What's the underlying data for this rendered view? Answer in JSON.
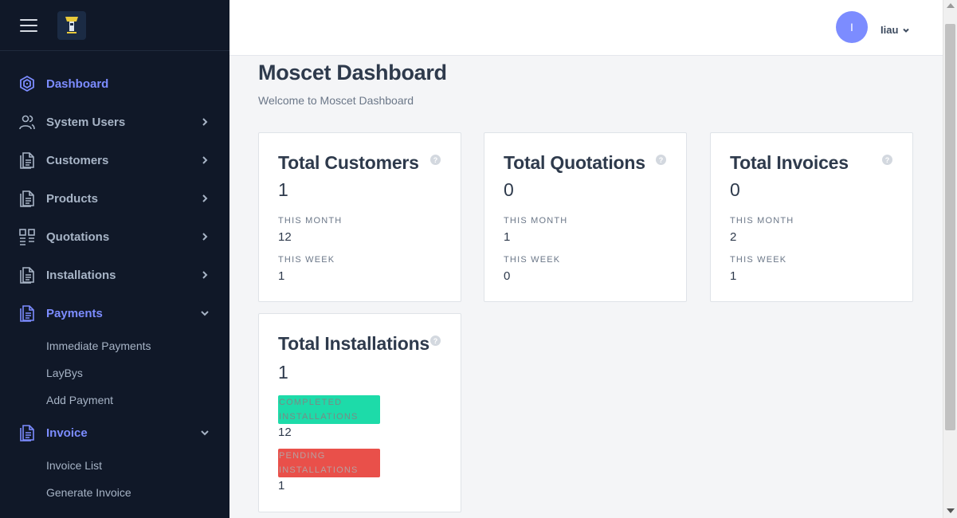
{
  "sidebar": {
    "items": [
      {
        "label": "Dashboard",
        "icon": "dashboard-icon"
      },
      {
        "label": "System Users",
        "icon": "users-icon"
      },
      {
        "label": "Customers",
        "icon": "document-icon"
      },
      {
        "label": "Products",
        "icon": "document-icon"
      },
      {
        "label": "Quotations",
        "icon": "grid-icon"
      },
      {
        "label": "Installations",
        "icon": "document-icon"
      },
      {
        "label": "Payments",
        "icon": "document-icon"
      },
      {
        "label": "Invoice",
        "icon": "document-icon"
      }
    ],
    "payments_sub": [
      "Immediate Payments",
      "LayBys",
      "Add Payment"
    ],
    "invoice_sub": [
      "Invoice List",
      "Generate Invoice"
    ]
  },
  "header": {
    "avatar_initial": "I",
    "username": "Iiau"
  },
  "main": {
    "title": "Moscet Dashboard",
    "subtitle": "Welcome to Moscet Dashboard",
    "cards": [
      {
        "title": "Total Customers",
        "value": "1",
        "this_month_label": "THIS MONTH",
        "this_month": "12",
        "this_week_label": "THIS WEEK",
        "this_week": "1"
      },
      {
        "title": "Total Quotations",
        "value": "0",
        "this_month_label": "THIS MONTH",
        "this_month": "1",
        "this_week_label": "THIS WEEK",
        "this_week": "0"
      },
      {
        "title": "Total Invoices",
        "value": "0",
        "this_month_label": "THIS MONTH",
        "this_month": "2",
        "this_week_label": "THIS WEEK",
        "this_week": "1"
      }
    ],
    "installations": {
      "title": "Total Installations",
      "value": "1",
      "completed_label": "COMPLETED INSTALLATIONS",
      "completed": "12",
      "pending_label": "PENDING INSTALLATIONS",
      "pending": "1"
    }
  },
  "colors": {
    "sidebar_bg": "#101828",
    "accent": "#7c8cff",
    "completed": "#1ddba9",
    "pending": "#e9504a"
  }
}
